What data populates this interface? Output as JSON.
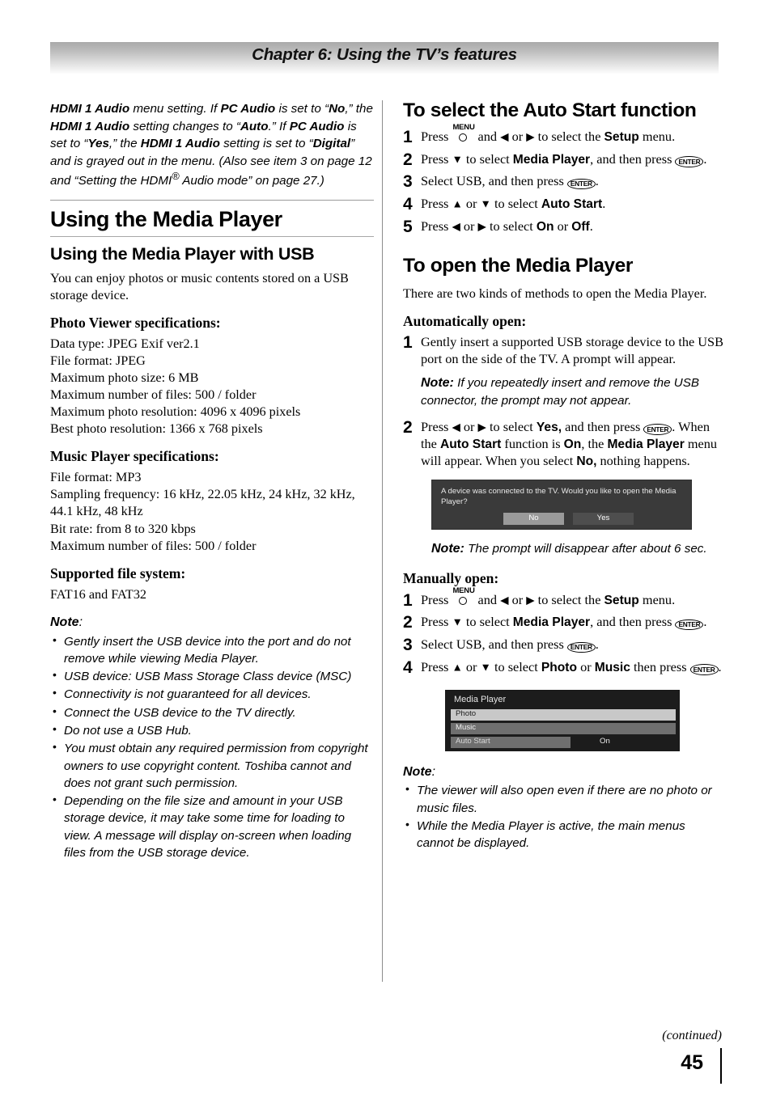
{
  "header": {
    "chapter_title": "Chapter 6: Using the TV’s features"
  },
  "left_column": {
    "intro_note": {
      "line1_a": "HDMI 1 Audio",
      "line1_b": " menu setting. If ",
      "line1_c": "PC Audio",
      "line2": " is set to “",
      "no": "No",
      "line2_b": ",” the ",
      "hdmi1": "HDMI 1 Audio",
      "line2_c": " setting changes to “",
      "auto": "Auto",
      "line3": ".” If ",
      "pcaudio2": "PC Audio",
      "line3_b": " is set to “",
      "yes": "Yes",
      "line3_c": ",” the ",
      "hdmi2": "HDMI 1 Audio",
      "line4": " setting is set to “",
      "digital": "Digital",
      "line4_b": "” and is grayed out in the menu. (Also see item 3 on page 12 and “Setting the HDMI",
      "reg": "®",
      "line5": " Audio mode” on page 27.)"
    },
    "section_title": "Using the Media Player",
    "subsection_title": "Using the Media Player with USB",
    "intro_paragraph": "You can enjoy photos or music contents stored on a USB storage device.",
    "photo_viewer_heading": "Photo Viewer specifications:",
    "photo_viewer_specs": [
      "Data type: JPEG Exif ver2.1",
      "File format: JPEG",
      "Maximum photo size: 6 MB",
      "Maximum number of files: 500 / folder",
      "Maximum photo resolution: 4096 x 4096 pixels",
      "Best photo resolution: 1366 x 768 pixels"
    ],
    "music_player_heading": "Music Player specifications:",
    "music_player_specs": [
      "File format: MP3",
      "Sampling frequency: 16 kHz, 22.05 kHz, 24 kHz, 32 kHz, 44.1 kHz, 48 kHz",
      "Bit rate: from 8 to 320 kbps",
      "Maximum number of files: 500 / folder"
    ],
    "file_system_heading": "Supported file system:",
    "file_system_value": "FAT16 and FAT32",
    "note_label": "Note",
    "note_colon": ":",
    "note_bullets": [
      "Gently insert the USB device into the port and do not remove while viewing Media Player.",
      "USB device: USB Mass Storage Class device (MSC)",
      "Connectivity is not guaranteed for all devices.",
      "Connect the USB device to the TV directly.",
      "Do not use a USB Hub.",
      "You must obtain any required permission from copyright owners to use copyright content. Toshiba cannot and does not grant such permission.",
      "Depending on the file size and amount in your USB storage device, it may take some time for loading to view. A message will display on-screen when loading files from the USB storage device."
    ]
  },
  "right_column": {
    "auto_start_heading": "To select the Auto Start function",
    "auto_start_steps": [
      {
        "num": "1",
        "parts": [
          "Press ",
          "MENU_ICON",
          " and ",
          "LEFT",
          " or ",
          "RIGHT",
          " to select the ",
          "Setup",
          " menu."
        ]
      },
      {
        "num": "2",
        "parts": [
          "Press ",
          "DOWN",
          " to select ",
          "Media Player",
          ", and then press ",
          "ENTER",
          "."
        ]
      },
      {
        "num": "3",
        "parts": [
          "Select USB, and then press ",
          "ENTER",
          "."
        ]
      },
      {
        "num": "4",
        "parts": [
          "Press ",
          "UP",
          " or ",
          "DOWN",
          " to select ",
          "Auto Start",
          "."
        ]
      },
      {
        "num": "5",
        "parts": [
          "Press ",
          "LEFT",
          " or ",
          "RIGHT",
          " to select ",
          "On",
          " or ",
          "Off",
          "."
        ]
      }
    ],
    "open_heading": "To open the Media Player",
    "open_intro": "There are two kinds of methods to open the Media Player.",
    "auto_open_heading": "Automatically open:",
    "auto_open_step1_num": "1",
    "auto_open_step1_text": "Gently insert a supported USB storage device to the USB port on the side of the TV. A prompt will appear.",
    "note1_label": "Note:",
    "note1_text": " If you repeatedly insert and remove the USB connector, the prompt may not appear.",
    "auto_open_step2_num": "2",
    "auto_open_step2": {
      "t1": "Press ",
      "t2": " or ",
      "t3": " to select ",
      "yes": "Yes,",
      "t4": " and then press ",
      "t5": ". When the ",
      "auto_start": "Auto Start",
      "t6": " function is ",
      "on": "On",
      "t7": ", the ",
      "media_player": "Media Player",
      "t8": " menu will appear. When you select ",
      "no": "No,",
      "t9": " nothing happens."
    },
    "tv_prompt": {
      "message": "A device was connected to the TV. Would you like to open the Media Player?",
      "button_no": "No",
      "button_yes": "Yes",
      "selected_button": "No",
      "bg_color": "#3a3a3a",
      "selected_color": "#9a9a9a",
      "unselected_color": "#4e4e4e"
    },
    "note2_label": "Note:",
    "note2_text": " The prompt will disappear after about 6 sec.",
    "manual_open_heading": "Manually open:",
    "manual_steps": [
      {
        "num": "1",
        "parts": [
          "Press ",
          "MENU_ICON",
          " and ",
          "LEFT",
          " or ",
          "RIGHT",
          " to select the ",
          "Setup",
          " menu."
        ]
      },
      {
        "num": "2",
        "parts": [
          "Press ",
          "DOWN",
          " to select ",
          "Media Player",
          ", and then press ",
          "ENTER",
          "."
        ]
      },
      {
        "num": "3",
        "parts": [
          "Select USB, and then press ",
          "ENTER",
          "."
        ]
      },
      {
        "num": "4",
        "parts": [
          "Press ",
          "UP",
          " or ",
          "DOWN",
          " to select ",
          "Photo",
          " or ",
          "Music",
          " then press ",
          "ENTER",
          "."
        ]
      }
    ],
    "media_player_menu": {
      "title": "Media Player",
      "rows": [
        {
          "label": "Photo",
          "value": "",
          "state": "highlighted"
        },
        {
          "label": "Music",
          "value": "",
          "state": "normal"
        },
        {
          "label": "Auto Start",
          "value": "On",
          "state": "normal"
        }
      ],
      "bg_color": "#1c1c1c",
      "highlight_color": "#c8c8c8",
      "row_color": "#6f6f6f"
    },
    "note3_label": "Note",
    "note3_colon": ":",
    "note3_bullets": [
      "The viewer will also open even if there are no photo or music files.",
      "While the Media Player is active, the main menus cannot be displayed."
    ]
  },
  "footer": {
    "continued": "(continued)",
    "page_number": "45"
  },
  "icons": {
    "menu": "menu-button-icon",
    "enter": "ENTER",
    "left": "◀",
    "right": "▶",
    "up": "▲",
    "down": "▼"
  }
}
